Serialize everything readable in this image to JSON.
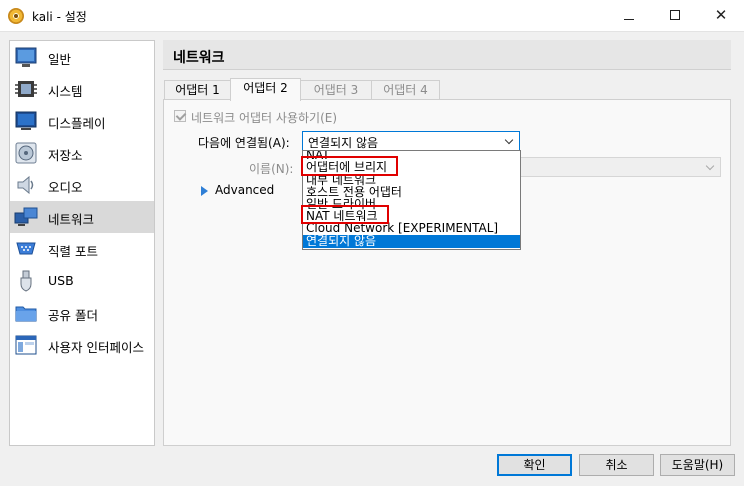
{
  "window": {
    "title": "kali - 설정",
    "icons": {
      "app": "virtualbox-icon",
      "minimize": "minimize-icon",
      "maximize": "maximize-icon",
      "close": "close-icon"
    }
  },
  "sidebar": {
    "items": [
      {
        "label": "일반",
        "icon": "general-icon"
      },
      {
        "label": "시스템",
        "icon": "system-icon"
      },
      {
        "label": "디스플레이",
        "icon": "display-icon"
      },
      {
        "label": "저장소",
        "icon": "storage-icon"
      },
      {
        "label": "오디오",
        "icon": "audio-icon"
      },
      {
        "label": "네트워크",
        "icon": "network-icon",
        "selected": true
      },
      {
        "label": "직렬 포트",
        "icon": "serial-port-icon"
      },
      {
        "label": "USB",
        "icon": "usb-icon"
      },
      {
        "label": "공유 폴더",
        "icon": "shared-folder-icon"
      },
      {
        "label": "사용자 인터페이스",
        "icon": "user-interface-icon"
      }
    ]
  },
  "main": {
    "title": "네트워크",
    "tabs": [
      {
        "label": "어댑터 1",
        "state": "normal"
      },
      {
        "label": "어댑터 2",
        "state": "active"
      },
      {
        "label": "어댑터 3",
        "state": "disabled"
      },
      {
        "label": "어댑터 4",
        "state": "disabled"
      }
    ],
    "enable_adapter": {
      "label": "네트워크 어댑터 사용하기(E)",
      "checked": true,
      "enabled": false
    },
    "attached_to": {
      "label": "다음에 연결됨(A):",
      "value": "연결되지 않음",
      "options": [
        "NAT",
        "어댑터에 브리지",
        "내부 네트워크",
        "호스트 전용 어댑터",
        "일반 드라이버",
        "NAT 네트워크",
        "Cloud Network [EXPERIMENTAL]",
        "연결되지 않음"
      ],
      "highlighted": "연결되지 않음",
      "marked_options": [
        "어댑터에 브리지",
        "NAT 네트워크"
      ],
      "mark_color": "#e00000"
    },
    "name": {
      "label": "이름(N):",
      "value": ""
    },
    "advanced": {
      "label": "Advanced"
    }
  },
  "buttons": {
    "ok": "확인",
    "cancel": "취소",
    "help": "도움말(H)"
  },
  "colors": {
    "accent": "#0078d7",
    "selected_row": "#d9d9d9"
  }
}
